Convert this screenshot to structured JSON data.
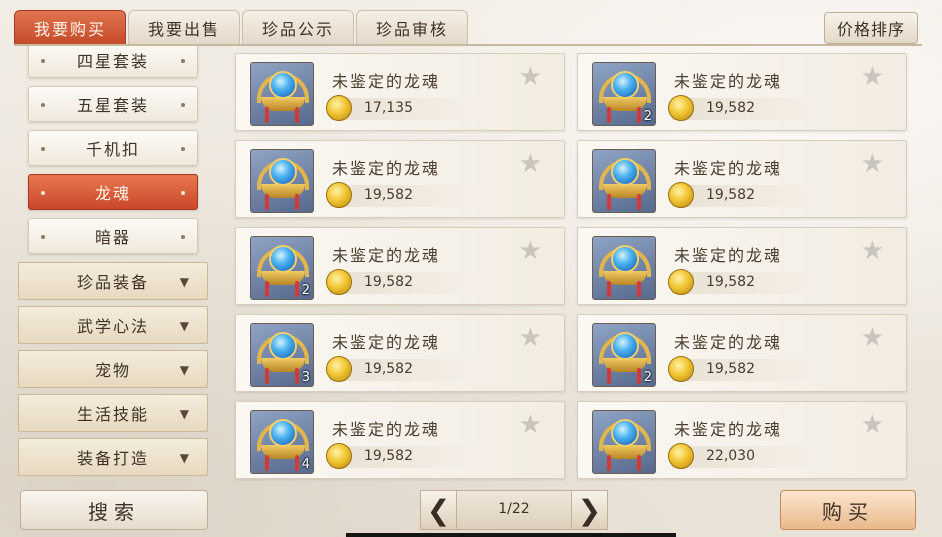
{
  "tabs": [
    {
      "label": "我要购买",
      "active": true
    },
    {
      "label": "我要出售",
      "active": false
    },
    {
      "label": "珍品公示",
      "active": false
    },
    {
      "label": "珍品审核",
      "active": false
    }
  ],
  "sort_button": "价格排序",
  "sidebar": {
    "sub_items": [
      {
        "label": "四星套装",
        "active": false
      },
      {
        "label": "五星套装",
        "active": false
      },
      {
        "label": "千机扣",
        "active": false
      },
      {
        "label": "龙魂",
        "active": true
      },
      {
        "label": "暗器",
        "active": false
      }
    ],
    "categories": [
      {
        "label": "珍品装备",
        "icon": "triangle-down-icon"
      },
      {
        "label": "武学心法",
        "icon": "triangle-down-icon"
      },
      {
        "label": "宠物",
        "icon": "triangle-down-icon"
      },
      {
        "label": "生活技能",
        "icon": "triangle-down-icon"
      },
      {
        "label": "装备打造",
        "icon": "triangle-down-icon"
      }
    ]
  },
  "glyphs": {
    "star": "★",
    "triangle": "▼",
    "prev": "❮",
    "next": "❯"
  },
  "items": [
    {
      "name": "未鉴定的龙魂",
      "price": "17,135",
      "count": ""
    },
    {
      "name": "未鉴定的龙魂",
      "price": "19,582",
      "count": "2"
    },
    {
      "name": "未鉴定的龙魂",
      "price": "19,582",
      "count": ""
    },
    {
      "name": "未鉴定的龙魂",
      "price": "19,582",
      "count": ""
    },
    {
      "name": "未鉴定的龙魂",
      "price": "19,582",
      "count": "2"
    },
    {
      "name": "未鉴定的龙魂",
      "price": "19,582",
      "count": ""
    },
    {
      "name": "未鉴定的龙魂",
      "price": "19,582",
      "count": "3"
    },
    {
      "name": "未鉴定的龙魂",
      "price": "19,582",
      "count": "2"
    },
    {
      "name": "未鉴定的龙魂",
      "price": "19,582",
      "count": "4"
    },
    {
      "name": "未鉴定的龙魂",
      "price": "22,030",
      "count": ""
    }
  ],
  "search_button": "搜索",
  "pager": {
    "current": "1/22"
  },
  "buy_button": "购买",
  "colors": {
    "accent": "#c9472a",
    "coin": "#f1c531",
    "orb": "#4ab2f0"
  }
}
